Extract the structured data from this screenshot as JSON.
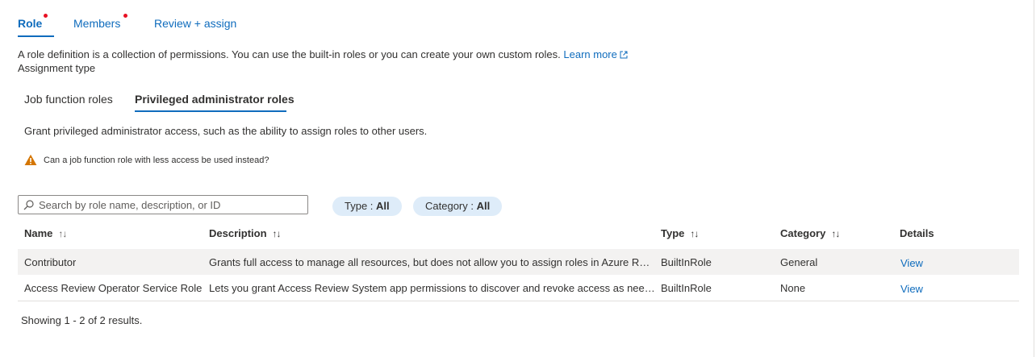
{
  "top_tabs": [
    {
      "label": "Role",
      "active": true,
      "required": true
    },
    {
      "label": "Members",
      "active": false,
      "required": true
    },
    {
      "label": "Review + assign",
      "active": false,
      "required": false
    }
  ],
  "description": {
    "text": "A role definition is a collection of permissions. You can use the built-in roles or you can create your own custom roles.",
    "link_label": "Learn more"
  },
  "assignment_type_label": "Assignment type",
  "sub_tabs": [
    {
      "label": "Job function roles",
      "active": false
    },
    {
      "label": "Privileged administrator roles",
      "active": true
    }
  ],
  "grant_text": "Grant privileged administrator access, such as the ability to assign roles to other users.",
  "warning_text": "Can a job function role with less access be used instead?",
  "search": {
    "placeholder": "Search by role name, description, or ID",
    "value": ""
  },
  "filters": [
    {
      "label": "Type : ",
      "value": "All"
    },
    {
      "label": "Category : ",
      "value": "All"
    }
  ],
  "table": {
    "columns": [
      "Name",
      "Description",
      "Type",
      "Category",
      "Details"
    ],
    "rows": [
      {
        "name": "Contributor",
        "description": "Grants full access to manage all resources, but does not allow you to assign roles in Azure RBA...",
        "type": "BuiltInRole",
        "category": "General",
        "details": "View",
        "selected": true
      },
      {
        "name": "Access Review Operator Service Role",
        "description": "Lets you grant Access Review System app permissions to discover and revoke access as neede...",
        "type": "BuiltInRole",
        "category": "None",
        "details": "View",
        "selected": false
      }
    ]
  },
  "results_text": "Showing 1 - 2 of 2 results.",
  "colors": {
    "accent": "#0f6cbd",
    "required_dot": "#e81123",
    "warning": "#d47500",
    "pill_bg": "#deecf9",
    "row_selected": "#f3f2f1"
  }
}
